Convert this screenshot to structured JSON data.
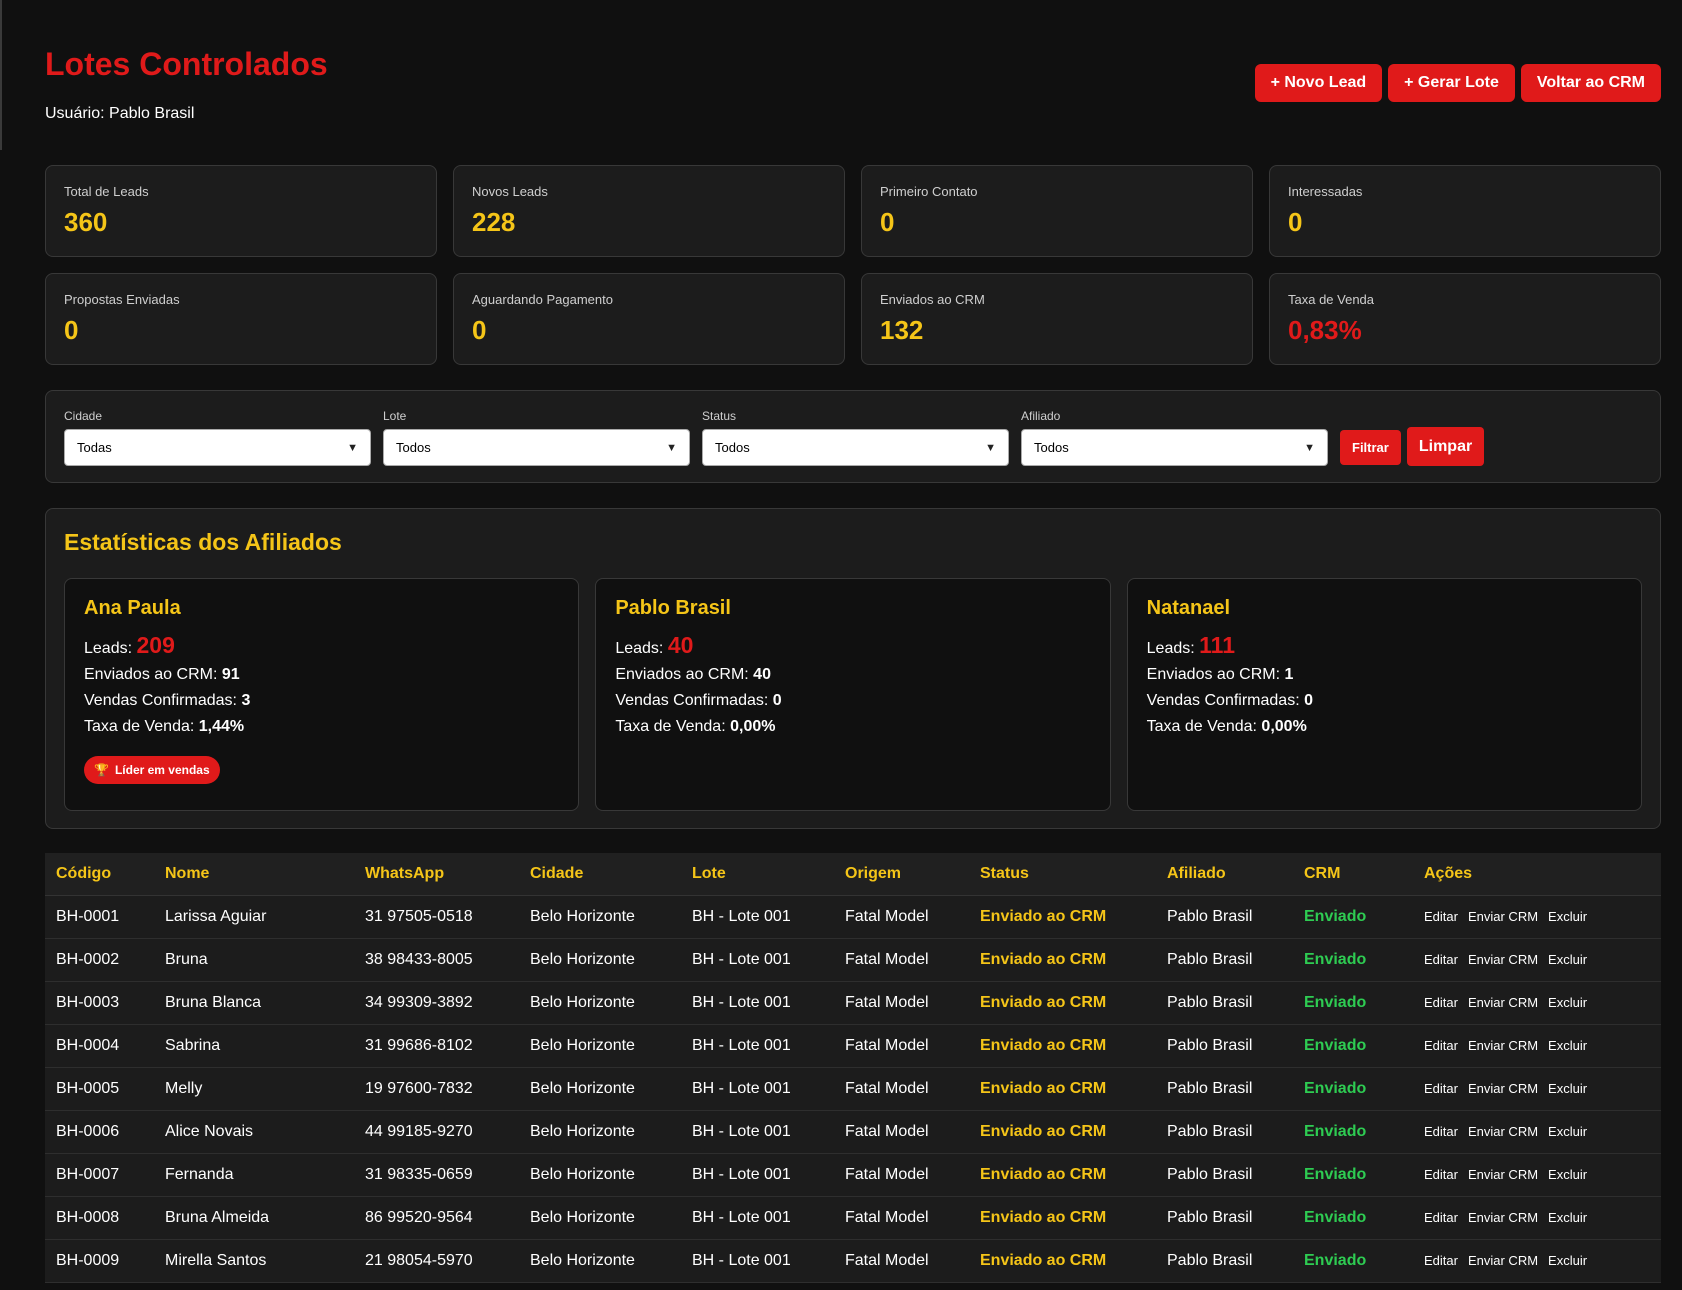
{
  "header": {
    "title": "Lotes Controlados",
    "user_line": "Usuário: Pablo Brasil",
    "actions": [
      "+ Novo Lead",
      "+ Gerar Lote",
      "Voltar ao CRM"
    ]
  },
  "stats": [
    {
      "label": "Total de Leads",
      "value": "360"
    },
    {
      "label": "Novos Leads",
      "value": "228"
    },
    {
      "label": "Primeiro Contato",
      "value": "0"
    },
    {
      "label": "Interessadas",
      "value": "0"
    },
    {
      "label": "Propostas Enviadas",
      "value": "0"
    },
    {
      "label": "Aguardando Pagamento",
      "value": "0"
    },
    {
      "label": "Enviados ao CRM",
      "value": "132"
    },
    {
      "label": "Taxa de Venda",
      "value": "0,83%"
    }
  ],
  "filters": {
    "fields": [
      {
        "label": "Cidade",
        "value": "Todas"
      },
      {
        "label": "Lote",
        "value": "Todos"
      },
      {
        "label": "Status",
        "value": "Todos"
      },
      {
        "label": "Afiliado",
        "value": "Todos"
      }
    ],
    "filter_button": "Filtrar",
    "clear_button": "Limpar"
  },
  "affiliates": {
    "title": "Estatísticas dos Afiliados",
    "labels": {
      "leads": "Leads:",
      "crm": "Enviados ao CRM:",
      "sales": "Vendas Confirmadas:",
      "rate": "Taxa de Venda:"
    },
    "cards": [
      {
        "name": "Ana Paula",
        "leads": "209",
        "crm": "91",
        "sales": "3",
        "rate": "1,44%",
        "badge": "Líder em vendas"
      },
      {
        "name": "Pablo Brasil",
        "leads": "40",
        "crm": "40",
        "sales": "0",
        "rate": "0,00%"
      },
      {
        "name": "Natanael",
        "leads": "111",
        "crm": "1",
        "sales": "0",
        "rate": "0,00%"
      }
    ]
  },
  "table": {
    "headers": [
      "Código",
      "Nome",
      "WhatsApp",
      "Cidade",
      "Lote",
      "Origem",
      "Status",
      "Afiliado",
      "CRM",
      "Ações"
    ],
    "actions": [
      "Editar",
      "Enviar CRM",
      "Excluir"
    ],
    "rows": [
      [
        "BH-0001",
        "Larissa Aguiar",
        "31 97505-0518",
        "Belo Horizonte",
        "BH - Lote 001",
        "Fatal Model",
        "Enviado ao CRM",
        "Pablo Brasil",
        "Enviado"
      ],
      [
        "BH-0002",
        "Bruna",
        "38 98433-8005",
        "Belo Horizonte",
        "BH - Lote 001",
        "Fatal Model",
        "Enviado ao CRM",
        "Pablo Brasil",
        "Enviado"
      ],
      [
        "BH-0003",
        "Bruna Blanca",
        "34 99309-3892",
        "Belo Horizonte",
        "BH - Lote 001",
        "Fatal Model",
        "Enviado ao CRM",
        "Pablo Brasil",
        "Enviado"
      ],
      [
        "BH-0004",
        "Sabrina",
        "31 99686-8102",
        "Belo Horizonte",
        "BH - Lote 001",
        "Fatal Model",
        "Enviado ao CRM",
        "Pablo Brasil",
        "Enviado"
      ],
      [
        "BH-0005",
        "Melly",
        "19 97600-7832",
        "Belo Horizonte",
        "BH - Lote 001",
        "Fatal Model",
        "Enviado ao CRM",
        "Pablo Brasil",
        "Enviado"
      ],
      [
        "BH-0006",
        "Alice Novais",
        "44 99185-9270",
        "Belo Horizonte",
        "BH - Lote 001",
        "Fatal Model",
        "Enviado ao CRM",
        "Pablo Brasil",
        "Enviado"
      ],
      [
        "BH-0007",
        "Fernanda",
        "31 98335-0659",
        "Belo Horizonte",
        "BH - Lote 001",
        "Fatal Model",
        "Enviado ao CRM",
        "Pablo Brasil",
        "Enviado"
      ],
      [
        "BH-0008",
        "Bruna Almeida",
        "86 99520-9564",
        "Belo Horizonte",
        "BH - Lote 001",
        "Fatal Model",
        "Enviado ao CRM",
        "Pablo Brasil",
        "Enviado"
      ],
      [
        "BH-0009",
        "Mirella Santos",
        "21 98054-5970",
        "Belo Horizonte",
        "BH - Lote 001",
        "Fatal Model",
        "Enviado ao CRM",
        "Pablo Brasil",
        "Enviado"
      ]
    ]
  },
  "colors": {
    "accent_red": "#e01a1a",
    "accent_yellow": "#f5c518",
    "crm_green": "#2ecc52",
    "background": "#101010",
    "card": "#1c1c1c"
  },
  "icons": {
    "badge_icon": "trophy-icon",
    "select_icon": "chevron-down-icon"
  }
}
